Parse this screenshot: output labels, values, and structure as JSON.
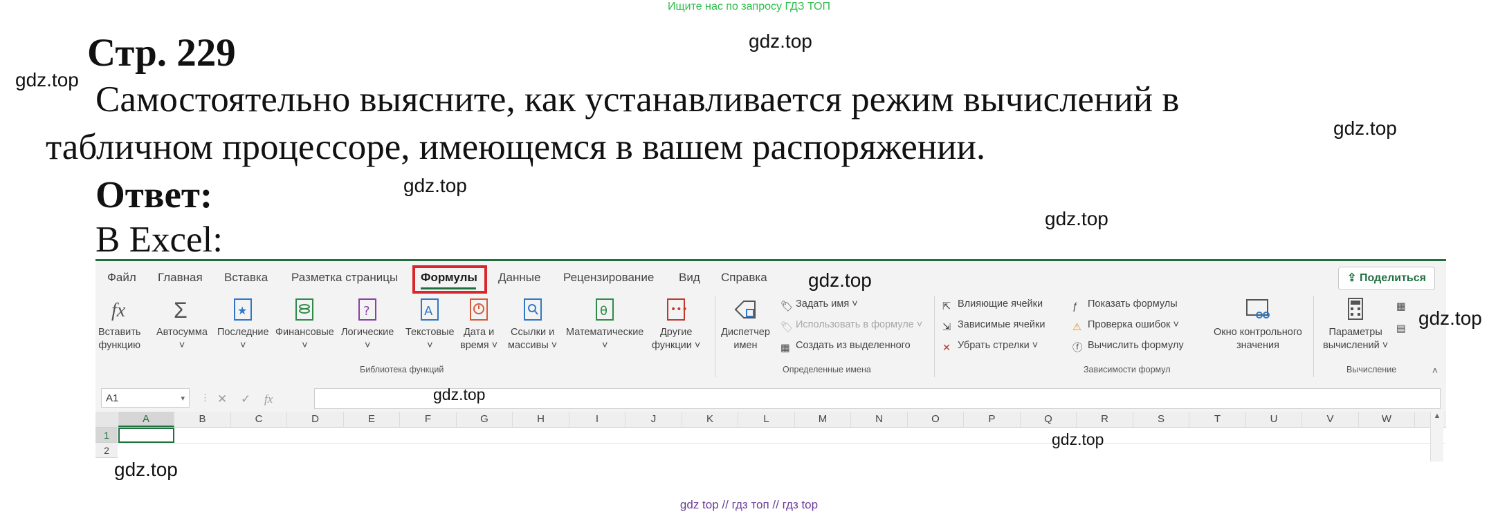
{
  "banner": "Ищите нас по запросу ГДЗ ТОП",
  "watermark": "gdz.top",
  "page_title": "Стр. 229",
  "question_line1": "Самостоятельно выясните, как устанавливается режим вычислений в",
  "question_line2": "табличном процессоре, имеющемся в вашем распоряжении.",
  "answer_label": "Ответ:",
  "answer_text": "В Excel:",
  "excel": {
    "tabs": [
      "Файл",
      "Главная",
      "Вставка",
      "Разметка страницы",
      "Формулы",
      "Данные",
      "Рецензирование",
      "Вид",
      "Справка"
    ],
    "share": "Поделиться",
    "functions_library": {
      "insert_function": [
        "Вставить",
        "функцию"
      ],
      "autosum": "Автосумма",
      "recent": "Последние",
      "financial": "Финансовые",
      "logical": "Логические",
      "text": "Текстовые",
      "datetime": [
        "Дата и",
        "время"
      ],
      "lookup": [
        "Ссылки и",
        "массивы"
      ],
      "math": "Математические",
      "other": [
        "Другие",
        "функции"
      ],
      "group_label": "Библиотека функций"
    },
    "defined_names": {
      "name_manager": [
        "Диспетчер",
        "имен"
      ],
      "define_name": "Задать имя",
      "use_in_formula": "Использовать в формуле",
      "create_from_selection": "Создать из выделенного",
      "group_label": "Определенные имена"
    },
    "formula_auditing": {
      "trace_precedents": "Влияющие ячейки",
      "trace_dependents": "Зависимые ячейки",
      "remove_arrows": "Убрать стрелки",
      "show_formulas": "Показать формулы",
      "error_checking": "Проверка ошибок",
      "evaluate_formula": "Вычислить формулу",
      "watch_window": [
        "Окно контрольного",
        "значения"
      ],
      "group_label": "Зависимости формул"
    },
    "calculation": {
      "options": [
        "Параметры",
        "вычислений"
      ],
      "group_label": "Вычисление"
    },
    "name_box": "A1",
    "fx": "fx",
    "columns": [
      "A",
      "B",
      "C",
      "D",
      "E",
      "F",
      "G",
      "H",
      "I",
      "J",
      "K",
      "L",
      "M",
      "N",
      "O",
      "P",
      "Q",
      "R",
      "S",
      "T",
      "U",
      "V",
      "W"
    ],
    "rows": [
      "1",
      "2"
    ]
  },
  "footer": "gdz top  //  гдз топ  //  гдз top"
}
